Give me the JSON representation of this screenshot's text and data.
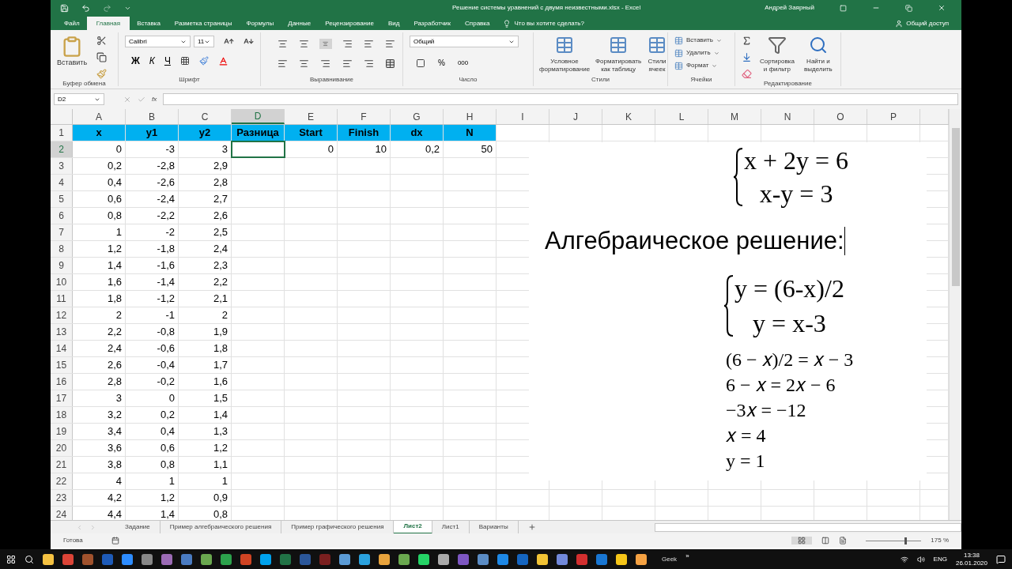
{
  "window": {
    "title": "Решение системы уравнений с двумя неизвестными.xlsx - Excel",
    "user": "Андрей Заярный"
  },
  "ribbon_tabs": [
    {
      "label": "Файл",
      "selected": false
    },
    {
      "label": "Главная",
      "selected": true
    },
    {
      "label": "Вставка",
      "selected": false
    },
    {
      "label": "Разметка страницы",
      "selected": false
    },
    {
      "label": "Формулы",
      "selected": false
    },
    {
      "label": "Данные",
      "selected": false
    },
    {
      "label": "Рецензирование",
      "selected": false
    },
    {
      "label": "Вид",
      "selected": false
    },
    {
      "label": "Разработчик",
      "selected": false
    },
    {
      "label": "Справка",
      "selected": false
    }
  ],
  "tell_me": "Что вы хотите сделать?",
  "share": "Общий доступ",
  "ribbon_groups": [
    {
      "kind": "clipboard",
      "label": "Буфер обмена",
      "buttons": [
        "Вставить"
      ]
    },
    {
      "kind": "font",
      "label": "Шрифт",
      "fields": [
        "Calibri",
        "11"
      ],
      "buttons": [
        "Ж",
        "К",
        "Ч"
      ]
    },
    {
      "kind": "alignment",
      "label": "Выравнивание"
    },
    {
      "kind": "number",
      "label": "Число",
      "fields": [
        "Общий"
      ],
      "buttons": [
        "%",
        "000"
      ]
    },
    {
      "kind": "styles",
      "label": "Стили",
      "buttons": [
        "Условное форматирование",
        "Форматировать как таблицу",
        "Стили ячеек"
      ]
    },
    {
      "kind": "cells",
      "label": "Ячейки",
      "buttons": [
        "Вставить",
        "Удалить",
        "Формат"
      ]
    },
    {
      "kind": "editing",
      "label": "Редактирование",
      "buttons": [
        "Сортировка и фильтр",
        "Найти и выделить"
      ]
    }
  ],
  "formula_bar": {
    "name_box": "D2",
    "fx": "fx"
  },
  "columns": [
    {
      "label": "A",
      "selected": false
    },
    {
      "label": "B",
      "selected": false
    },
    {
      "label": "C",
      "selected": false
    },
    {
      "label": "D",
      "selected": true
    },
    {
      "label": "E",
      "selected": false
    },
    {
      "label": "F",
      "selected": false
    },
    {
      "label": "G",
      "selected": false
    },
    {
      "label": "H",
      "selected": false
    },
    {
      "label": "I",
      "selected": false
    },
    {
      "label": "J",
      "selected": false
    },
    {
      "label": "K",
      "selected": false
    },
    {
      "label": "L",
      "selected": false
    },
    {
      "label": "M",
      "selected": false
    },
    {
      "label": "N",
      "selected": false
    },
    {
      "label": "O",
      "selected": false
    },
    {
      "label": "P",
      "selected": false
    }
  ],
  "header_row": {
    "label": "1",
    "selected": false,
    "cells": [
      "x",
      "y1",
      "y2",
      "Разница",
      "Start",
      "Finish",
      "dx",
      "N"
    ]
  },
  "rows": [
    {
      "label": "2",
      "selected": true,
      "values": [
        "0",
        "-3",
        "3"
      ],
      "params": [
        "0",
        "10",
        "0,2",
        "50"
      ]
    },
    {
      "label": "3",
      "selected": false,
      "values": [
        "0,2",
        "-2,8",
        "2,9"
      ]
    },
    {
      "label": "4",
      "selected": false,
      "values": [
        "0,4",
        "-2,6",
        "2,8"
      ]
    },
    {
      "label": "5",
      "selected": false,
      "values": [
        "0,6",
        "-2,4",
        "2,7"
      ]
    },
    {
      "label": "6",
      "selected": false,
      "values": [
        "0,8",
        "-2,2",
        "2,6"
      ]
    },
    {
      "label": "7",
      "selected": false,
      "values": [
        "1",
        "-2",
        "2,5"
      ]
    },
    {
      "label": "8",
      "selected": false,
      "values": [
        "1,2",
        "-1,8",
        "2,4"
      ]
    },
    {
      "label": "9",
      "selected": false,
      "values": [
        "1,4",
        "-1,6",
        "2,3"
      ]
    },
    {
      "label": "10",
      "selected": false,
      "values": [
        "1,6",
        "-1,4",
        "2,2"
      ]
    },
    {
      "label": "11",
      "selected": false,
      "values": [
        "1,8",
        "-1,2",
        "2,1"
      ]
    },
    {
      "label": "12",
      "selected": false,
      "values": [
        "2",
        "-1",
        "2"
      ]
    },
    {
      "label": "13",
      "selected": false,
      "values": [
        "2,2",
        "-0,8",
        "1,9"
      ]
    },
    {
      "label": "14",
      "selected": false,
      "values": [
        "2,4",
        "-0,6",
        "1,8"
      ]
    },
    {
      "label": "15",
      "selected": false,
      "values": [
        "2,6",
        "-0,4",
        "1,7"
      ]
    },
    {
      "label": "16",
      "selected": false,
      "values": [
        "2,8",
        "-0,2",
        "1,6"
      ]
    },
    {
      "label": "17",
      "selected": false,
      "values": [
        "3",
        "0",
        "1,5"
      ]
    },
    {
      "label": "18",
      "selected": false,
      "values": [
        "3,2",
        "0,2",
        "1,4"
      ]
    },
    {
      "label": "19",
      "selected": false,
      "values": [
        "3,4",
        "0,4",
        "1,3"
      ]
    },
    {
      "label": "20",
      "selected": false,
      "values": [
        "3,6",
        "0,6",
        "1,2"
      ]
    },
    {
      "label": "21",
      "selected": false,
      "values": [
        "3,8",
        "0,8",
        "1,1"
      ]
    },
    {
      "label": "22",
      "selected": false,
      "values": [
        "4",
        "1",
        "1"
      ]
    },
    {
      "label": "23",
      "selected": false,
      "values": [
        "4,2",
        "1,2",
        "0,9"
      ]
    },
    {
      "label": "24",
      "selected": false,
      "values": [
        "4,4",
        "1,4",
        "0,8"
      ]
    }
  ],
  "text_box": {
    "system1": [
      "x + 2y = 6",
      "x-y = 3"
    ],
    "heading": "Алгебраическое решение:",
    "system2": [
      "y = (6-x)/2",
      "y = x-3"
    ],
    "steps": [
      "(6 − 𝑥)/2 = 𝑥 − 3",
      "6 − 𝑥 = 2𝑥 − 6",
      "−3𝑥 = −12",
      "𝑥 = 4",
      "y = 1"
    ]
  },
  "sheet_tabs": [
    {
      "label": "Задание",
      "selected": false
    },
    {
      "label": "Пример алгебраического решения",
      "selected": false
    },
    {
      "label": "Пример графического решения",
      "selected": false
    },
    {
      "label": "Лист2",
      "selected": true
    },
    {
      "label": "Лист1",
      "selected": false
    },
    {
      "label": "Варианты",
      "selected": false
    }
  ],
  "status_bar": {
    "status": "Готова",
    "zoom": "175 %",
    "zoom_slider": {
      "level": 0.7
    }
  },
  "taskbar": {
    "user_label": "Geek",
    "overflow": "»",
    "language": "ENG",
    "time": "13:38",
    "date": "26.01.2020"
  }
}
